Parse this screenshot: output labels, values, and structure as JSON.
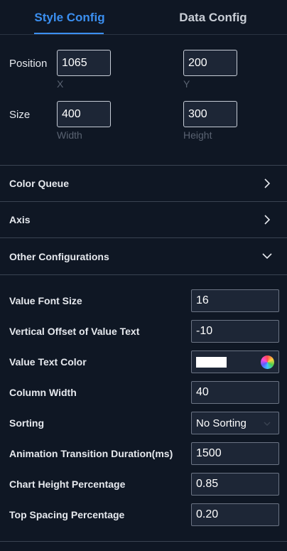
{
  "tabs": {
    "style_config": "Style Config",
    "data_config": "Data Config"
  },
  "position": {
    "label": "Position",
    "x_value": "1065",
    "x_label": "X",
    "y_value": "200",
    "y_label": "Y"
  },
  "size": {
    "label": "Size",
    "width_value": "400",
    "width_label": "Width",
    "height_value": "300",
    "height_label": "Height"
  },
  "sections": {
    "color_queue": "Color Queue",
    "axis": "Axis",
    "other_configurations": "Other Configurations"
  },
  "other": {
    "value_font_size": {
      "label": "Value Font Size",
      "value": "16"
    },
    "vertical_offset": {
      "label": "Vertical Offset of Value Text",
      "value": "-10"
    },
    "value_text_color": {
      "label": "Value Text Color",
      "color": "#ffffff"
    },
    "column_width": {
      "label": "Column Width",
      "value": "40"
    },
    "sorting": {
      "label": "Sorting",
      "value": "No Sorting"
    },
    "animation_duration": {
      "label": "Animation Transition Duration(ms)",
      "value": "1500"
    },
    "chart_height_pct": {
      "label": "Chart Height Percentage",
      "value": "0.85"
    },
    "top_spacing_pct": {
      "label": "Top Spacing Percentage",
      "value": "0.20"
    }
  },
  "colors": {
    "accent": "#3b8ff0",
    "background": "#0f1724"
  }
}
